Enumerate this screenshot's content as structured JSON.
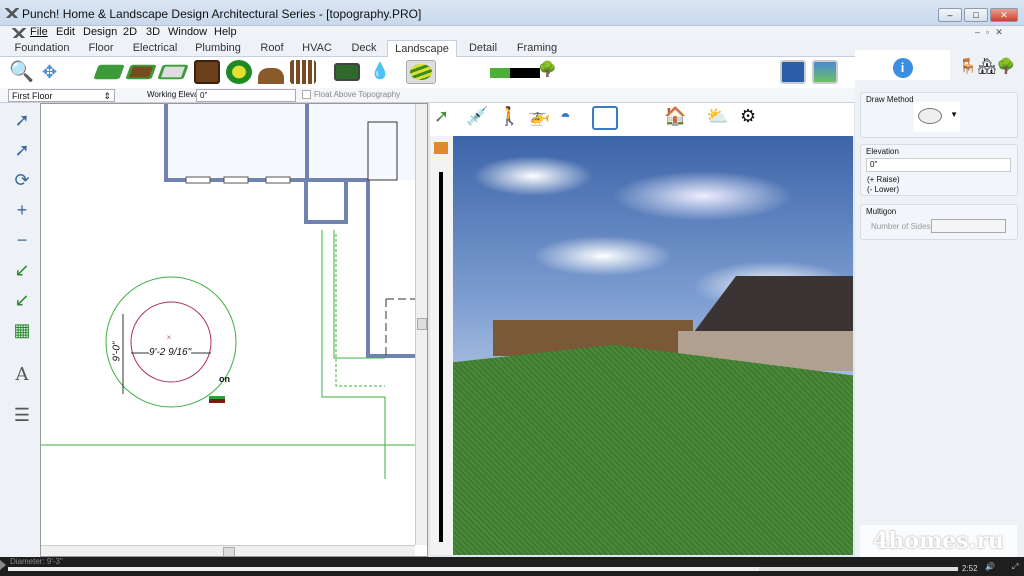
{
  "window": {
    "title": "Punch! Home & Landscape Design Architectural Series - [topography.PRO]"
  },
  "menu": [
    "File",
    "Edit",
    "Design",
    "2D",
    "3D",
    "Window",
    "Help"
  ],
  "tabs": [
    "Foundation",
    "Floor",
    "Electrical",
    "Plumbing",
    "Roof",
    "HVAC",
    "Deck",
    "Landscape",
    "Detail",
    "Framing"
  ],
  "active_tab": "Landscape",
  "options": {
    "floor": "First Floor",
    "working_elevation_label": "Working Elevation:",
    "working_elevation_value": "0\"",
    "float_label": "Float Above Topography",
    "float_checked": false
  },
  "plan": {
    "dim_vertical": "9'-0\"",
    "dim_horizontal": "9'-2 9/16\"",
    "cursor_label": "on"
  },
  "panel": {
    "draw_method_label": "Draw Method",
    "elevation_label": "Elevation",
    "elevation_value": "0\"",
    "raise": "(+ Raise)",
    "lower": "(- Lower)",
    "multigon_label": "Multigon",
    "sides_label": "Number of Sides:",
    "sides_value": ""
  },
  "status": {
    "text": "Diameter:  9'-3\""
  },
  "video": {
    "time": "2:52",
    "progress": 0.79
  },
  "watermark": "4homes.ru",
  "colors": {
    "accent": "#3b8ee0",
    "wall": "#6f82b0",
    "landscape_line": "#3cb043",
    "circle_inner": "#b03050"
  }
}
